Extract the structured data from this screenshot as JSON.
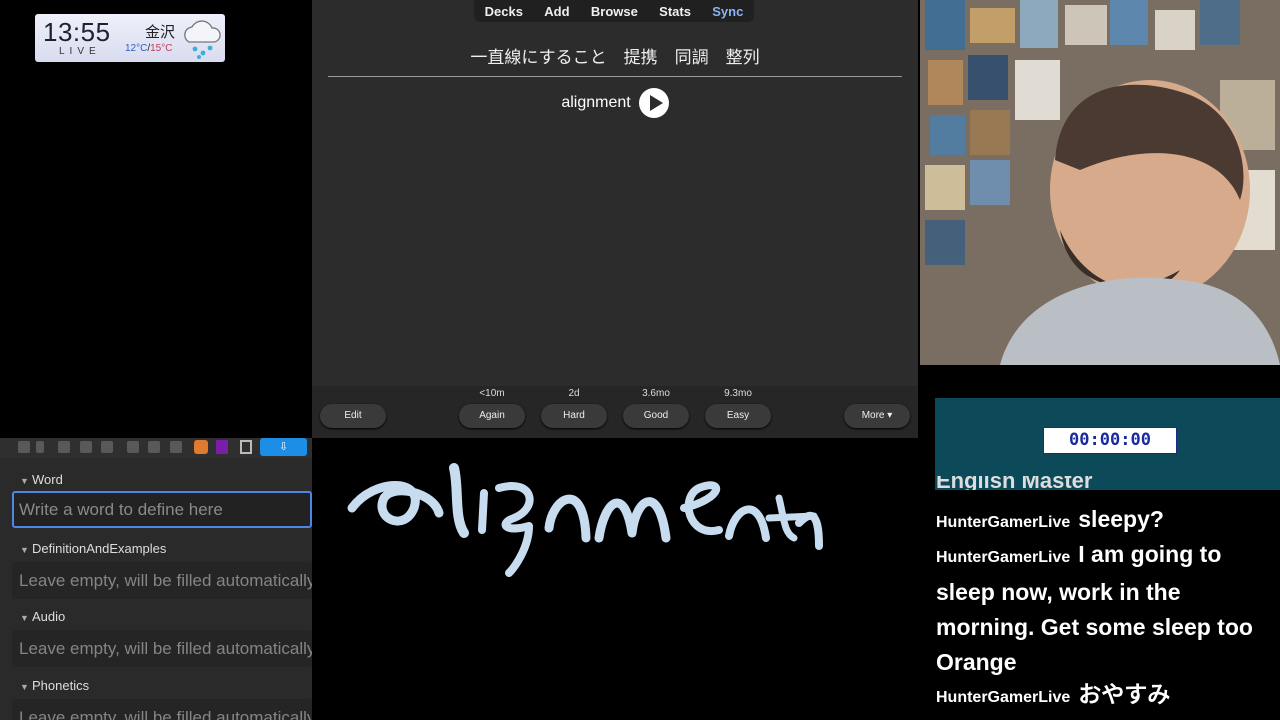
{
  "weather": {
    "time": "13:55",
    "live": "LIVE",
    "city": "金沢",
    "temp_low": "12°C",
    "temp_sep": "/",
    "temp_high": "15°C",
    "icon": "rain-cloud-icon"
  },
  "anki": {
    "nav": [
      "Decks",
      "Add",
      "Browse",
      "Stats",
      "Sync"
    ],
    "card_front": "一直線にすること　提携　同調　整列",
    "card_back_word": "alignment",
    "edit_label": "Edit",
    "answers": [
      {
        "due": "<10m",
        "label": "Again"
      },
      {
        "due": "2d",
        "label": "Hard"
      },
      {
        "due": "3.6mo",
        "label": "Good"
      },
      {
        "due": "9.3mo",
        "label": "Easy"
      }
    ],
    "more_label": "More ▾"
  },
  "editor": {
    "fields": [
      {
        "label": "Word",
        "placeholder": "Write a word to define here"
      },
      {
        "label": "DefinitionAndExamples",
        "placeholder": "Leave empty, will be filled automatically"
      },
      {
        "label": "Audio",
        "placeholder": "Leave empty, will be filled automatically"
      },
      {
        "label": "Phonetics",
        "placeholder": "Leave empty, will be filled automatically"
      }
    ]
  },
  "timer": "00:00:00",
  "chat": {
    "clipped_top": "English Master",
    "messages": [
      {
        "user": "HunterGamerLive",
        "text": "sleepy?"
      },
      {
        "user": "HunterGamerLive",
        "text": "I am going to sleep now, work in the morning. Get some sleep too Orange"
      },
      {
        "user": "HunterGamerLive",
        "text": "おやすみ"
      }
    ]
  },
  "colors": {
    "anki_bg": "#2c2c2c",
    "sync_accent": "#8ab4f8",
    "timer_bg": "#0c4a5a",
    "ink": "#c8dcf0",
    "focus": "#4f86e6"
  }
}
